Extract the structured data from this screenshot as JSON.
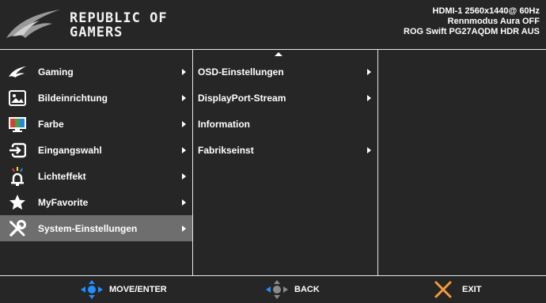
{
  "header": {
    "brand_line1": "REPUBLIC OF",
    "brand_line2": "GAMERS",
    "status_line1": "HDMI-1  2560x1440@  60Hz",
    "status_line2": "Rennmodus   Aura OFF",
    "status_line3": "ROG Swift   PG27AQDM   HDR AUS"
  },
  "main_menu": {
    "items": [
      {
        "label": "Gaming",
        "icon": "rog-eye-icon"
      },
      {
        "label": "Bildeinrichtung",
        "icon": "picture-icon"
      },
      {
        "label": "Farbe",
        "icon": "color-monitor-icon"
      },
      {
        "label": "Eingangswahl",
        "icon": "input-icon"
      },
      {
        "label": "Lichteffekt",
        "icon": "light-effect-icon"
      },
      {
        "label": "MyFavorite",
        "icon": "star-icon"
      },
      {
        "label": "System-Einstellungen",
        "icon": "wrench-screwdriver-icon",
        "selected": true
      }
    ]
  },
  "sub_menu": {
    "items": [
      {
        "label": "OSD-Einstellungen",
        "has_arrow": true
      },
      {
        "label": "DisplayPort-Stream",
        "has_arrow": true
      },
      {
        "label": "Information",
        "has_arrow": false
      },
      {
        "label": "Fabrikseinst",
        "has_arrow": true
      }
    ]
  },
  "footer": {
    "move_label": "MOVE/ENTER",
    "back_label": "BACK",
    "exit_label": "EXIT"
  },
  "colors": {
    "background": "#262626",
    "selected": "#6e6e6e",
    "nav_blue": "#1e90ff",
    "exit_orange": "#f59a3a"
  }
}
